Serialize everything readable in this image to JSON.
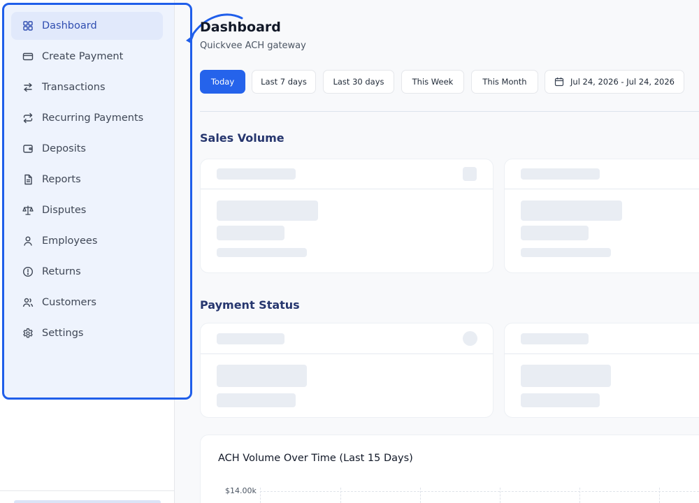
{
  "sidebar": {
    "items": [
      {
        "label": "Dashboard",
        "icon": "grid-icon",
        "active": true
      },
      {
        "label": "Create Payment",
        "icon": "credit-card-icon"
      },
      {
        "label": "Transactions",
        "icon": "arrows-left-right-icon"
      },
      {
        "label": "Recurring Payments",
        "icon": "repeat-icon"
      },
      {
        "label": "Deposits",
        "icon": "wallet-icon"
      },
      {
        "label": "Reports",
        "icon": "document-icon"
      },
      {
        "label": "Disputes",
        "icon": "scale-icon"
      },
      {
        "label": "Employees",
        "icon": "user-icon"
      },
      {
        "label": "Returns",
        "icon": "alert-circle-icon"
      },
      {
        "label": "Customers",
        "icon": "users-icon"
      },
      {
        "label": "Settings",
        "icon": "gear-icon"
      }
    ]
  },
  "header": {
    "title": "Dashboard",
    "subtitle": "Quickvee ACH gateway"
  },
  "filters": {
    "today": "Today",
    "last7": "Last 7 days",
    "last30": "Last 30 days",
    "week": "This Week",
    "month": "This Month",
    "date_range": "Jul 24, 2026 - Jul 24, 2026",
    "selected": "Today"
  },
  "sections": {
    "sales_volume": "Sales Volume",
    "payment_status": "Payment Status"
  },
  "chart": {
    "title": "ACH Volume Over Time (Last 15 Days)",
    "top_tick": "$14.00k"
  },
  "colors": {
    "accent": "#2563eb",
    "highlight": "#1f5eea",
    "section_title": "#26366e"
  }
}
